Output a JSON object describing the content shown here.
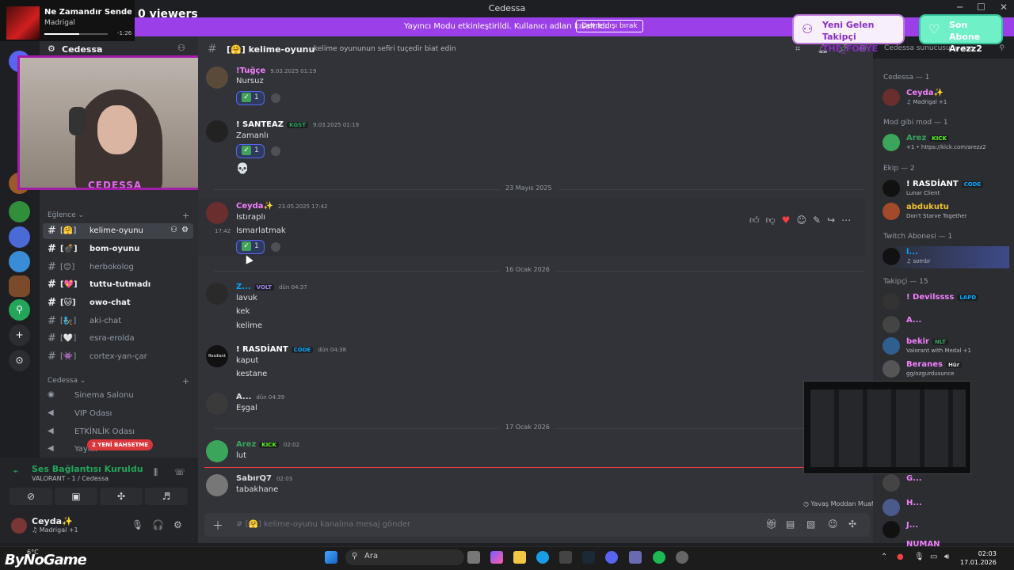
{
  "window": {
    "title": "Cedessa"
  },
  "overlay": {
    "song": "Ne Zamandır Sendeyi...",
    "artist": "Madrigal",
    "song_time": "-1:26",
    "song_progress": 0.55,
    "viewers": "0 viewers",
    "webcam_name": "CEDESSA",
    "alert_follow": {
      "title": "Yeni Gelen Takipçi",
      "name": "THE_FOXYE"
    },
    "alert_sub": {
      "title": "Son Abone",
      "name": "Arezz2"
    }
  },
  "banner": {
    "message": "Yayıncı Modu etkinleştirildi. Kullanıcı adları kısaltıldı.",
    "button": "Devre dışı bırak"
  },
  "server": {
    "name": "Cedessa"
  },
  "sidebar": {
    "categories": {
      "eglence": "Eğlence",
      "cedessa": "Cedessa"
    },
    "channels": [
      {
        "label": "kelime-oyunu",
        "prefix": "[🤗]"
      },
      {
        "label": "bom-oyunu",
        "prefix": "[💣]"
      },
      {
        "label": "herbokolog",
        "prefix": "[😊]"
      },
      {
        "label": "tuttu-tutmadı",
        "prefix": "[💖]"
      },
      {
        "label": "owo-chat",
        "prefix": "[🐱]"
      },
      {
        "label": "aki-chat",
        "prefix": "[🧞]"
      },
      {
        "label": "esra-erolda",
        "prefix": "[🤍]"
      },
      {
        "label": "cortex-yan-çar",
        "prefix": "[👾]"
      }
    ],
    "voice_channels": [
      "Sinema Salonu",
      "VIP Odası",
      "ETKİNLİK Odası",
      "Yayı..."
    ],
    "new_mentions": "2 YENİ BAHSETME"
  },
  "voice": {
    "status": "Ses Bağlantısı Kuruldu",
    "sub": "VALORANT - 1 / Cedessa"
  },
  "user": {
    "name": "Ceyda✨",
    "status": "♫ Madrigal +1"
  },
  "channel": {
    "name": "kelime-oyunu",
    "prefix": "[🤗]",
    "topic": "kelime oyununun sefiri tuçedir biat edin",
    "search_placeholder": "Cedessa sunucusunu ara",
    "composer_placeholder": "kelime-oyunu kanalına mesaj gönder",
    "slowmode": "Yavaş Moddan Muaf"
  },
  "messages": [
    {
      "author": "!Tuğçe",
      "time": "9.03.2025 01:19",
      "lines": [
        "Nursuz"
      ],
      "reaction": "1"
    },
    {
      "author": "! SANTEAZ",
      "badge": "KGST",
      "time": "9.03.2025 01:19",
      "lines": [
        "Zamanlı"
      ],
      "reaction": "1",
      "extra": "💀"
    },
    {
      "author": "Ceyda✨",
      "time": "23.05.2025 17:42",
      "lines": [
        "Istıraplı",
        "Ismarlatmak"
      ],
      "inline_time": "17:42",
      "reaction": "1"
    },
    {
      "author": "Z...",
      "badge": "VOLT",
      "time": "dün 04:37",
      "lines": [
        "lavuk",
        "kek",
        "kelime"
      ]
    },
    {
      "author": "! RASDİANT",
      "badge": "CODE",
      "time": "dün 04:38",
      "lines": [
        "kaput",
        "kestane"
      ]
    },
    {
      "author": "A...",
      "time": "dün 04:39",
      "lines": [
        "Eşgal"
      ]
    },
    {
      "author": "Arez",
      "badge": "KICK",
      "time": "02:02",
      "lines": [
        "lut"
      ]
    },
    {
      "author": "SabırQ7",
      "time": "02:03",
      "lines": [
        "tabakhane"
      ]
    }
  ],
  "dividers": [
    "23 Mayıs 2025",
    "16 Ocak 2026",
    "17 Ocak 2026"
  ],
  "members": {
    "groups": [
      "Cedessa — 1",
      "Mod gibi mod — 1",
      "Ekip — 2",
      "Twitch Abonesi — 1",
      "Takipçi — 15"
    ],
    "list": [
      {
        "name": "Ceyda✨",
        "activity": "♫ Madrigal +1",
        "color": "#f47fff"
      },
      {
        "name": "Arez",
        "badge": "KICK",
        "activity": "+1 • https://kick.com/arezz2",
        "color": "#3ba55c"
      },
      {
        "name": "! RASDİANT",
        "badge": "CODE",
        "activity": "Lunar Client",
        "color": "#ffffff"
      },
      {
        "name": "abdukutu",
        "activity": "Don't Starve Together",
        "color": "#f0c030"
      },
      {
        "name": "l...",
        "activity": "♫ sombr",
        "color": "#00a8fc"
      },
      {
        "name": "! Devilssss",
        "badge": "LAPD",
        "activity": "",
        "color": "#f47fff"
      },
      {
        "name": "A...",
        "activity": "",
        "color": "#f47fff"
      },
      {
        "name": "bekir",
        "badge": "NLT",
        "activity": "Valorant with Medal +1",
        "color": "#f47fff"
      },
      {
        "name": "Beranes",
        "badge": "Hür",
        "activity": "gg/ozgurdusunce",
        "color": "#f47fff"
      },
      {
        "name": "G...",
        "activity": "",
        "color": "#f47fff"
      },
      {
        "name": "H...",
        "activity": "",
        "color": "#f47fff"
      },
      {
        "name": "J...",
        "activity": "",
        "color": "#f47fff"
      },
      {
        "name": "NUMAN",
        "activity": "",
        "color": "#f47fff"
      }
    ]
  },
  "taskbar": {
    "search": "Ara",
    "time": "02:03",
    "date": "17.01.2026",
    "weather": "6°C",
    "watermark": "ByNoGame"
  }
}
